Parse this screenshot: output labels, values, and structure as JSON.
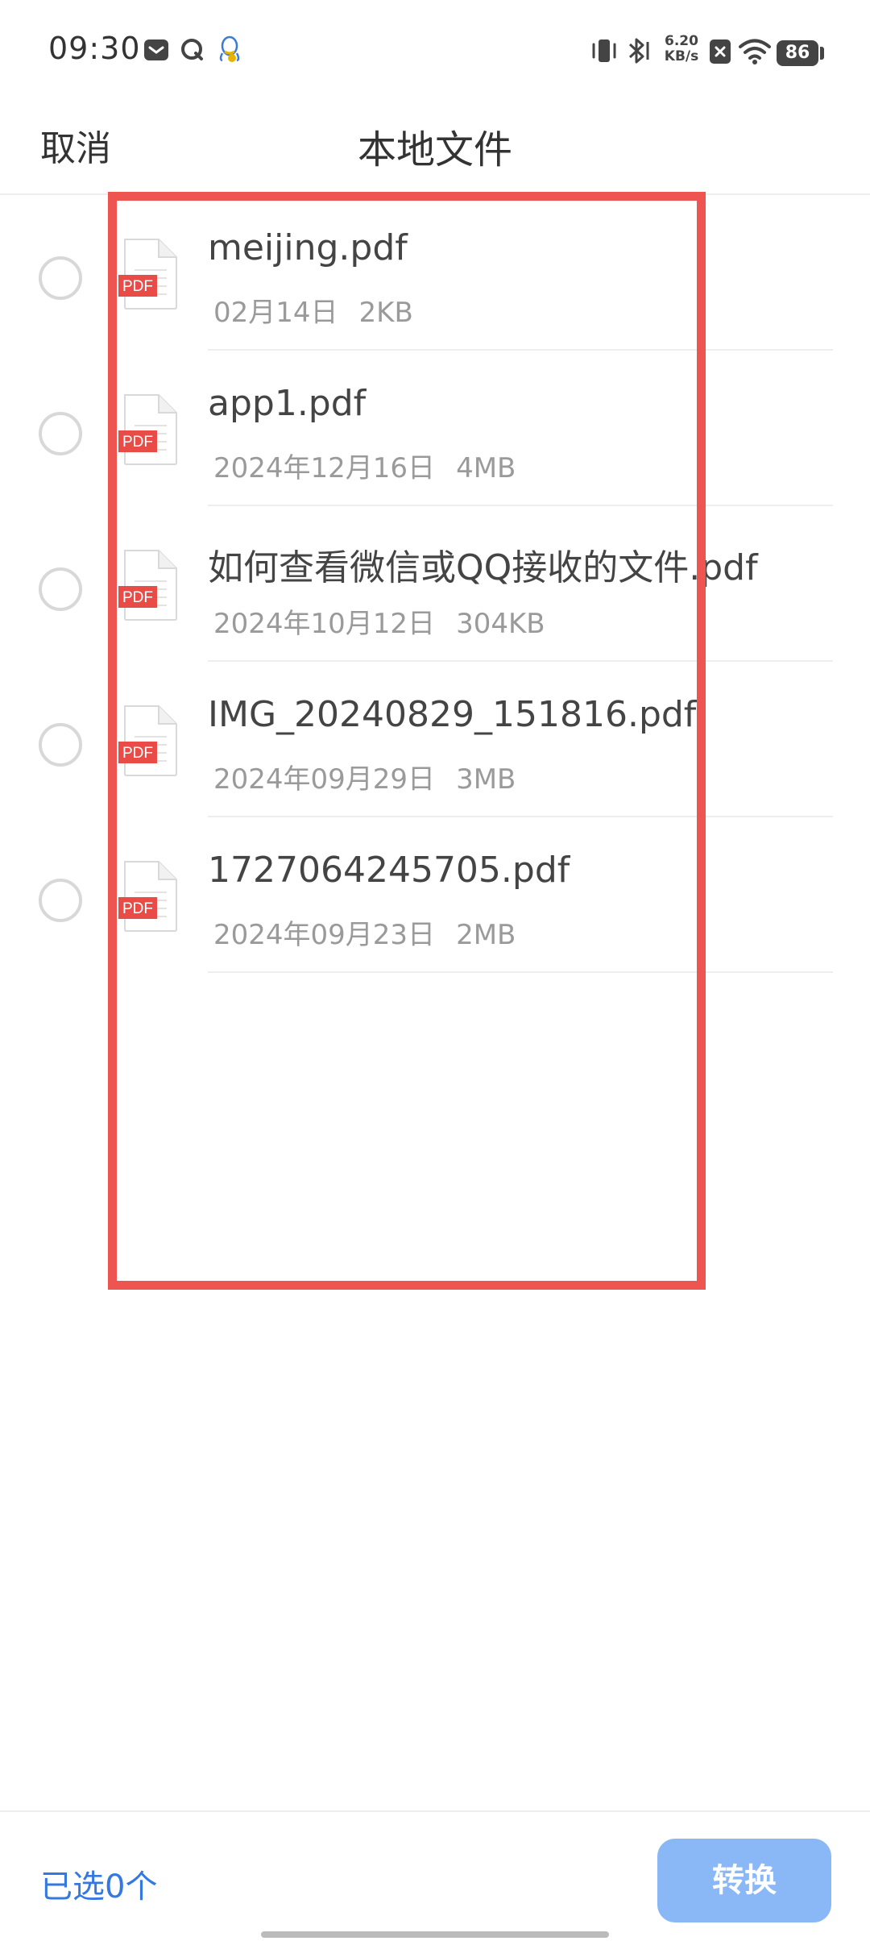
{
  "status_bar": {
    "time": "09:30",
    "net_speed_value": "6.20",
    "net_speed_unit": "KB/s",
    "battery_level": "86",
    "icons": [
      "mail-icon",
      "q-app-icon",
      "qq-icon",
      "vibrate-icon",
      "bluetooth-icon",
      "sim-blocked-icon",
      "wifi-icon",
      "battery-icon"
    ]
  },
  "header": {
    "cancel_label": "取消",
    "title": "本地文件"
  },
  "files": [
    {
      "name": "meijing.pdf",
      "date": "02月14日",
      "size": "2KB",
      "icon_badge": "PDF",
      "selected": false
    },
    {
      "name": "app1.pdf",
      "date": "2024年12月16日",
      "size": "4MB",
      "icon_badge": "PDF",
      "selected": false
    },
    {
      "name": "如何查看微信或QQ接收的文件.pdf",
      "date": "2024年10月12日",
      "size": "304KB",
      "icon_badge": "PDF",
      "selected": false
    },
    {
      "name": "IMG_20240829_151816.pdf",
      "date": "2024年09月29日",
      "size": "3MB",
      "icon_badge": "PDF",
      "selected": false
    },
    {
      "name": "1727064245705.pdf",
      "date": "2024年09月23日",
      "size": "2MB",
      "icon_badge": "PDF",
      "selected": false
    }
  ],
  "footer": {
    "selected_count_label": "已选0个",
    "convert_label": "转换"
  },
  "colors": {
    "highlight": "#ee5450",
    "accent": "#3478e0",
    "button_disabled": "#8ab8f6",
    "pdf_badge": "#e94b47"
  }
}
